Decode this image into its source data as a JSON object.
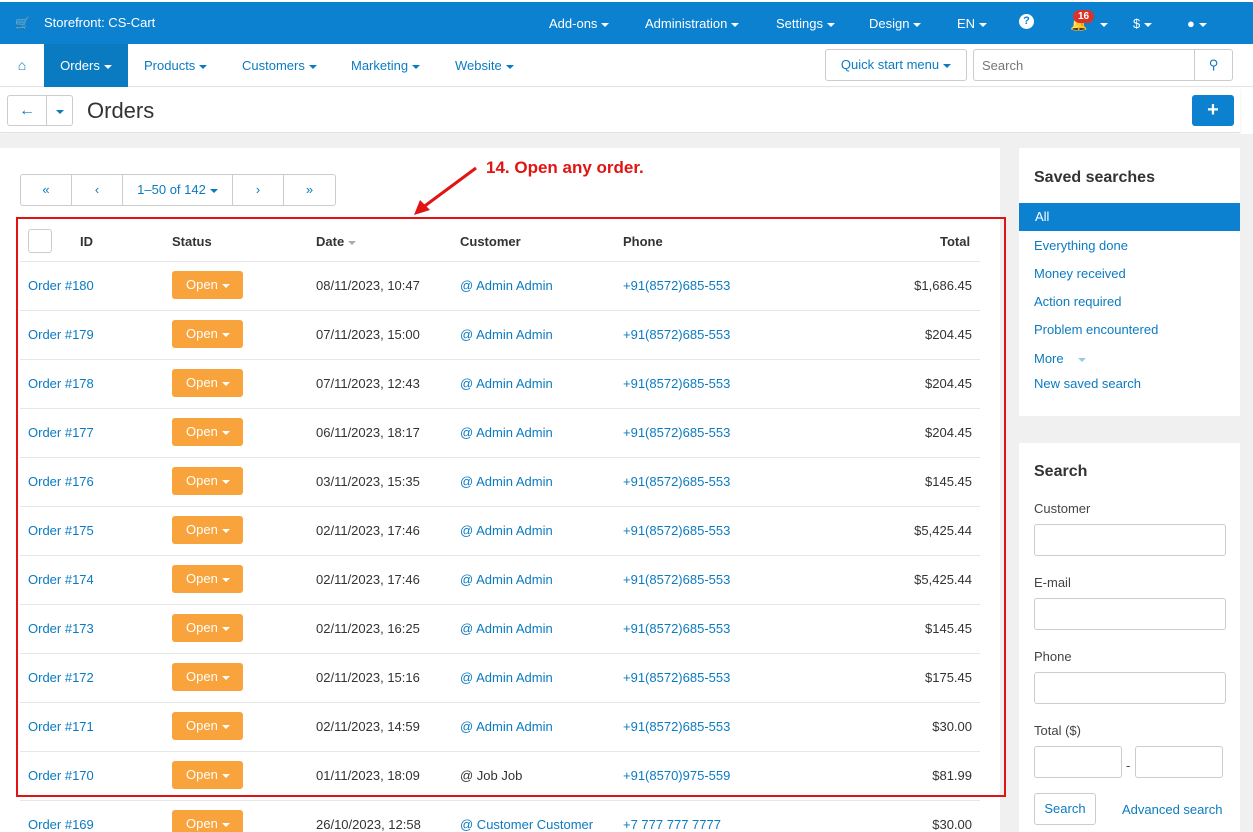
{
  "topbar": {
    "brand": "Storefront: CS-Cart",
    "menus": [
      "Add-ons",
      "Administration",
      "Settings",
      "Design",
      "EN"
    ],
    "notification_count": "16",
    "currency": "$"
  },
  "nav": {
    "items": [
      "Orders",
      "Products",
      "Customers",
      "Marketing",
      "Website"
    ],
    "quick_start": "Quick start menu",
    "search_placeholder": "Search"
  },
  "page": {
    "title": "Orders"
  },
  "pager": {
    "range": "1–50 of 142",
    "first": "«",
    "prev": "‹",
    "next": "›",
    "last": "»"
  },
  "annotation": "14. Open any order.",
  "table": {
    "columns": [
      "ID",
      "Status",
      "Date",
      "Customer",
      "Phone",
      "Total"
    ],
    "rows": [
      {
        "id": "Order #180",
        "status": "Open",
        "date": "08/11/2023, 10:47",
        "customer": "@ Admin Admin",
        "phone": "+91(8572)685-553",
        "total": "$1,686.45"
      },
      {
        "id": "Order #179",
        "status": "Open",
        "date": "07/11/2023, 15:00",
        "customer": "@ Admin Admin",
        "phone": "+91(8572)685-553",
        "total": "$204.45"
      },
      {
        "id": "Order #178",
        "status": "Open",
        "date": "07/11/2023, 12:43",
        "customer": "@ Admin Admin",
        "phone": "+91(8572)685-553",
        "total": "$204.45"
      },
      {
        "id": "Order #177",
        "status": "Open",
        "date": "06/11/2023, 18:17",
        "customer": "@ Admin Admin",
        "phone": "+91(8572)685-553",
        "total": "$204.45"
      },
      {
        "id": "Order #176",
        "status": "Open",
        "date": "03/11/2023, 15:35",
        "customer": "@ Admin Admin",
        "phone": "+91(8572)685-553",
        "total": "$145.45"
      },
      {
        "id": "Order #175",
        "status": "Open",
        "date": "02/11/2023, 17:46",
        "customer": "@ Admin Admin",
        "phone": "+91(8572)685-553",
        "total": "$5,425.44"
      },
      {
        "id": "Order #174",
        "status": "Open",
        "date": "02/11/2023, 17:46",
        "customer": "@ Admin Admin",
        "phone": "+91(8572)685-553",
        "total": "$5,425.44"
      },
      {
        "id": "Order #173",
        "status": "Open",
        "date": "02/11/2023, 16:25",
        "customer": "@ Admin Admin",
        "phone": "+91(8572)685-553",
        "total": "$145.45"
      },
      {
        "id": "Order #172",
        "status": "Open",
        "date": "02/11/2023, 15:16",
        "customer": "@ Admin Admin",
        "phone": "+91(8572)685-553",
        "total": "$175.45"
      },
      {
        "id": "Order #171",
        "status": "Open",
        "date": "02/11/2023, 14:59",
        "customer": "@ Admin Admin",
        "phone": "+91(8572)685-553",
        "total": "$30.00"
      },
      {
        "id": "Order #170",
        "status": "Open",
        "date": "01/11/2023, 18:09",
        "customer": "@ Job Job",
        "phone": "+91(8570)975-559",
        "total": "$81.99"
      },
      {
        "id": "Order #169",
        "status": "Open",
        "date": "26/10/2023, 12:58",
        "customer": "@ Customer Customer",
        "phone": "+7 777 777 7777",
        "total": "$30.00"
      }
    ]
  },
  "saved_searches": {
    "title": "Saved searches",
    "items": [
      "All",
      "Everything done",
      "Money received",
      "Action required",
      "Problem encountered",
      "More",
      "New saved search"
    ]
  },
  "search_panel": {
    "title": "Search",
    "labels": [
      "Customer",
      "E-mail",
      "Phone",
      "Total ($)"
    ],
    "range_sep": "-",
    "search_button": "Search",
    "advanced": "Advanced search"
  }
}
